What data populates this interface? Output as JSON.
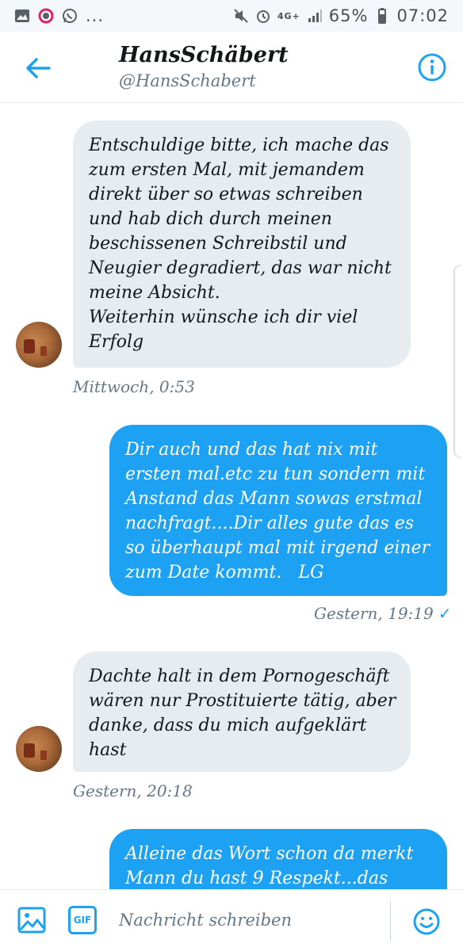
{
  "status_bar": {
    "left_icons": [
      "image-icon",
      "circle-app-icon",
      "whatsapp-icon"
    ],
    "more": "...",
    "network": "4G+",
    "battery": "65%",
    "time": "07:02"
  },
  "header": {
    "name": "HansSchäbert",
    "handle": "@HansSchabert"
  },
  "messages": [
    {
      "direction": "received",
      "lines": [
        "Entschuldige bitte, ich mache das",
        "zum ersten Mal, mit jemandem",
        "direkt über so etwas schreiben",
        "und hab dich durch meinen",
        "beschissenen Schreibstil und",
        "Neugier degradiert, das war nicht",
        "meine Absicht.",
        "Weiterhin wünsche ich dir viel",
        "Erfolg"
      ],
      "timestamp": "Mittwoch, 0:53"
    },
    {
      "direction": "sent",
      "lines": [
        "Dir auch und das hat nix mit",
        "ersten mal.etc zu tun sondern mit",
        "Anstand das Mann sowas erstmal",
        "nachfragt....Dir alles gute das es",
        "so überhaupt mal mit irgend einer",
        "zum Date kommt.   LG"
      ],
      "timestamp": "Gestern, 19:19",
      "status": "✓"
    },
    {
      "direction": "received",
      "lines": [
        "Dachte halt in dem Pornogeschäft",
        "wären nur Prostituierte tätig, aber",
        "danke, dass du mich aufgeklärt",
        "hast"
      ],
      "timestamp": "Gestern, 20:18"
    },
    {
      "direction": "sent",
      "lines": [
        "Alleine das Wort schon da merkt",
        "Mann du hast 9 Respekt...das"
      ]
    }
  ],
  "compose": {
    "gif_label": "GIF",
    "placeholder": "Nachricht schreiben"
  },
  "colors": {
    "accent": "#1da1f2",
    "received_bubble": "#e6ecf0",
    "meta_text": "#657786"
  }
}
